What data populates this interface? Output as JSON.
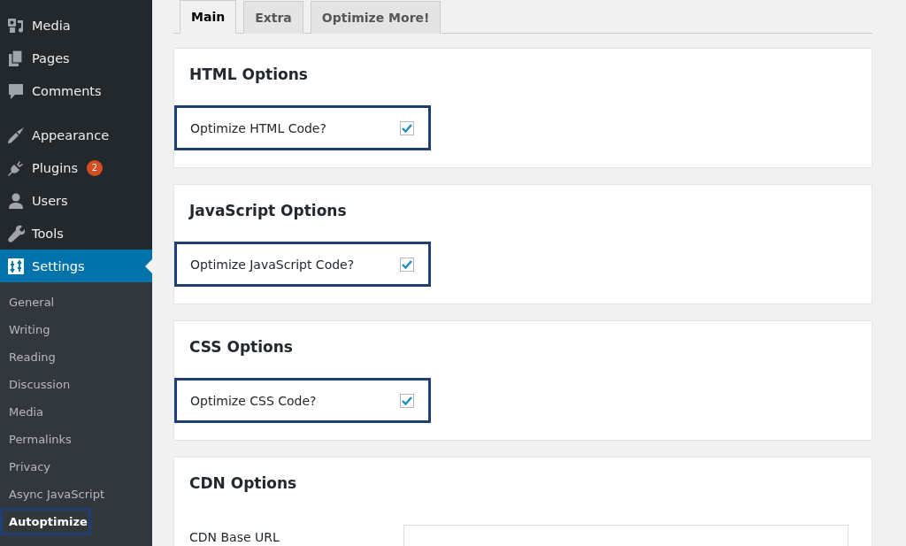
{
  "sidebar": {
    "menu": [
      {
        "label": "Media",
        "selected": false
      },
      {
        "label": "Pages",
        "selected": false
      },
      {
        "label": "Comments",
        "selected": false
      },
      {
        "label": "Appearance",
        "selected": false
      },
      {
        "label": "Plugins",
        "selected": false,
        "badge": "2"
      },
      {
        "label": "Users",
        "selected": false
      },
      {
        "label": "Tools",
        "selected": false
      },
      {
        "label": "Settings",
        "selected": true
      }
    ],
    "submenu": [
      {
        "label": "General",
        "selected": false,
        "highlighted": false
      },
      {
        "label": "Writing",
        "selected": false,
        "highlighted": false
      },
      {
        "label": "Reading",
        "selected": false,
        "highlighted": false
      },
      {
        "label": "Discussion",
        "selected": false,
        "highlighted": false
      },
      {
        "label": "Media",
        "selected": false,
        "highlighted": false
      },
      {
        "label": "Permalinks",
        "selected": false,
        "highlighted": false
      },
      {
        "label": "Privacy",
        "selected": false,
        "highlighted": false
      },
      {
        "label": "Async JavaScript",
        "selected": false,
        "highlighted": false
      },
      {
        "label": "Autoptimize",
        "selected": true,
        "highlighted": true
      }
    ]
  },
  "tabs": [
    {
      "label": "Main",
      "selected": true
    },
    {
      "label": "Extra",
      "selected": false
    },
    {
      "label": "Optimize More!",
      "selected": false
    }
  ],
  "sections": [
    {
      "title": "HTML Options",
      "options": [
        {
          "label": "Optimize HTML Code?",
          "checked": true,
          "highlighted": true
        }
      ]
    },
    {
      "title": "JavaScript Options",
      "options": [
        {
          "label": "Optimize JavaScript Code?",
          "checked": true,
          "highlighted": true
        }
      ]
    },
    {
      "title": "CSS Options",
      "options": [
        {
          "label": "Optimize CSS Code?",
          "checked": true,
          "highlighted": true
        }
      ]
    },
    {
      "title": "CDN Options",
      "fields": [
        {
          "label": "CDN Base URL"
        }
      ]
    }
  ]
}
